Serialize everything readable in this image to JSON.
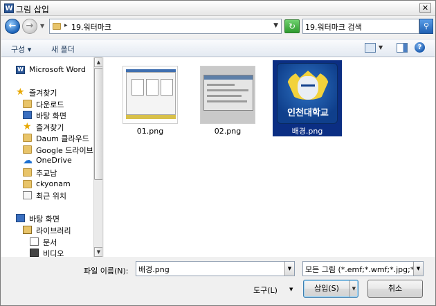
{
  "window": {
    "title": "그림 삽입",
    "close_glyph": "✕"
  },
  "address": {
    "crumb_arrow": "▸",
    "path": "19.워터마크"
  },
  "search": {
    "value": "19.워터마크 검색"
  },
  "toolbar": {
    "organize": "구성 ▾",
    "new_folder": "새 폴더"
  },
  "sidebar": {
    "items": [
      {
        "label": "Microsoft Word",
        "icon": "word-icon"
      },
      {
        "label": "즐겨찾기",
        "icon": "star-icon"
      },
      {
        "label": "다운로드",
        "icon": "folder-icon"
      },
      {
        "label": "바탕 화면",
        "icon": "desktop-icon"
      },
      {
        "label": "즐겨찾기",
        "icon": "star-icon"
      },
      {
        "label": "Daum 클라우드",
        "icon": "folder-icon"
      },
      {
        "label": "Google 드라이브",
        "icon": "folder-icon"
      },
      {
        "label": "OneDrive",
        "icon": "cloud-icon"
      },
      {
        "label": "추교남",
        "icon": "folder-icon"
      },
      {
        "label": "ckyonam",
        "icon": "folder-icon"
      },
      {
        "label": "최근 위치",
        "icon": "recent-icon"
      },
      {
        "label": "바탕 화면",
        "icon": "desktop-icon"
      },
      {
        "label": "라이브러리",
        "icon": "library-icon"
      },
      {
        "label": "문서",
        "icon": "document-icon"
      },
      {
        "label": "비디오",
        "icon": "video-icon"
      }
    ]
  },
  "files": [
    {
      "name": "01.png",
      "thumb": "word-screenshot"
    },
    {
      "name": "02.png",
      "thumb": "dialog-screenshot"
    },
    {
      "name": "배경.png",
      "thumb": "university-logo",
      "selected": true,
      "logo_text": "인천대학교"
    }
  ],
  "form": {
    "filename_label": "파일 이름(N):",
    "filename_value": "배경.png",
    "filetype_value": "모든 그림 (*.emf;*.wmf;*.jpg;*.j",
    "tools_label": "도구(L)",
    "insert_label": "삽입(S)",
    "cancel_label": "취소"
  },
  "colors": {
    "selection": "#0b2e83",
    "accent": "#1c63b8"
  }
}
